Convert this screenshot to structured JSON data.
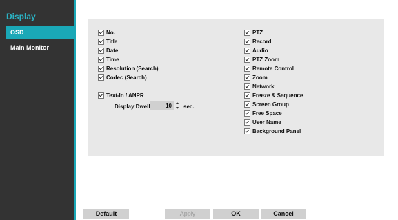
{
  "sidebar": {
    "title": "Display",
    "items": [
      {
        "label": "OSD"
      },
      {
        "label": "Main Monitor"
      }
    ]
  },
  "options_left": [
    {
      "label": "No.",
      "checked": true
    },
    {
      "label": "Title",
      "checked": true
    },
    {
      "label": "Date",
      "checked": true
    },
    {
      "label": "Time",
      "checked": true
    },
    {
      "label": "Resolution (Search)",
      "checked": true
    },
    {
      "label": "Codec (Search)",
      "checked": true
    }
  ],
  "text_in": {
    "label": "Text-In / ANPR",
    "checked": true
  },
  "display_dwell": {
    "label": "Display Dwell",
    "value": "10",
    "unit": "sec."
  },
  "options_right": [
    {
      "label": "PTZ",
      "checked": true
    },
    {
      "label": "Record",
      "checked": true
    },
    {
      "label": "Audio",
      "checked": true
    },
    {
      "label": "PTZ Zoom",
      "checked": true
    },
    {
      "label": "Remote Control",
      "checked": true
    },
    {
      "label": "Zoom",
      "checked": true
    },
    {
      "label": "Network",
      "checked": true
    },
    {
      "label": "Freeze & Sequence",
      "checked": true
    },
    {
      "label": "Screen Group",
      "checked": true
    },
    {
      "label": "Free Space",
      "checked": true
    },
    {
      "label": "User Name",
      "checked": true
    },
    {
      "label": "Background Panel",
      "checked": true
    }
  ],
  "buttons": {
    "default": "Default",
    "apply": "Apply",
    "ok": "OK",
    "cancel": "Cancel"
  },
  "colors": {
    "accent": "#1aa8b7",
    "sidebar_bg": "#333333",
    "panel_bg": "#e8e8e8"
  }
}
